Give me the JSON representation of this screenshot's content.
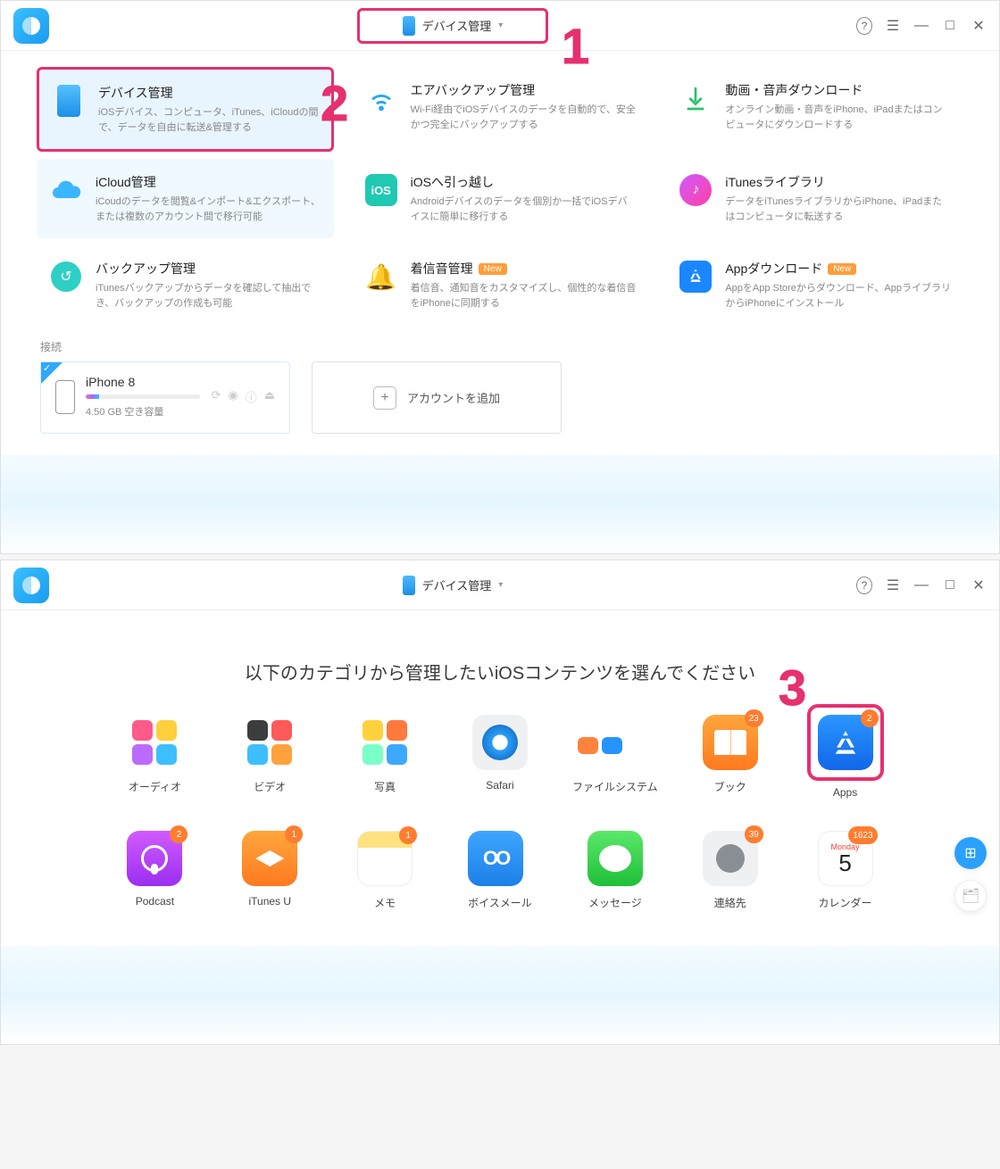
{
  "top_dropdown": "デバイス管理",
  "annotations": {
    "one": "1",
    "two": "2",
    "three": "3"
  },
  "features": [
    {
      "id": "device",
      "title": "デバイス管理",
      "desc": "iOSデバイス、コンピュータ、iTunes、iCloudの間で、データを自由に転送&管理する"
    },
    {
      "id": "air",
      "title": "エアバックアップ管理",
      "desc": "Wi-Fi経由でiOSデバイスのデータを自動的で、安全かつ完全にバックアップする"
    },
    {
      "id": "media",
      "title": "動画・音声ダウンロード",
      "desc": "オンライン動画・音声をiPhone、iPadまたはコンピュータにダウンロードする"
    },
    {
      "id": "icloud",
      "title": "iCloud管理",
      "desc": "iCoudのデータを閲覧&インポート&エクスポート、または複数のアカウント間で移行可能"
    },
    {
      "id": "move",
      "title": "iOSへ引っ越し",
      "desc": "Androidデバイスのデータを個別か一括でiOSデバイスに簡単に移行する"
    },
    {
      "id": "itunes",
      "title": "iTunesライブラリ",
      "desc": "データをiTunesライブラリからiPhone、iPadまたはコンピュータに転送する"
    },
    {
      "id": "backup",
      "title": "バックアップ管理",
      "desc": "iTunesバックアップからデータを確認して抽出でき、バックアップの作成も可能"
    },
    {
      "id": "ring",
      "title": "着信音管理",
      "desc": "着信音、通知音をカスタマイズし、個性的な着信音をiPhoneに同期する",
      "badge": "New"
    },
    {
      "id": "appdl",
      "title": "Appダウンロード",
      "desc": "AppをApp Storeからダウンロード、AppライブラリからiPhoneにインストール",
      "badge": "New"
    }
  ],
  "connect_label": "接続",
  "device": {
    "name": "iPhone 8",
    "storage": "4.50 GB 空き容量"
  },
  "add_account": "アカウントを追加",
  "w2_heading": "以下のカテゴリから管理したいiOSコンテンツを選んでください",
  "categories": [
    {
      "id": "audio",
      "label": "オーディオ"
    },
    {
      "id": "video",
      "label": "ビデオ"
    },
    {
      "id": "photo",
      "label": "写真"
    },
    {
      "id": "safari",
      "label": "Safari"
    },
    {
      "id": "files",
      "label": "ファイルシステム"
    },
    {
      "id": "book",
      "label": "ブック",
      "count": "23"
    },
    {
      "id": "apps",
      "label": "Apps",
      "count": "2"
    },
    {
      "id": "podcast",
      "label": "Podcast",
      "count": "2"
    },
    {
      "id": "itunesu",
      "label": "iTunes U",
      "count": "1"
    },
    {
      "id": "memo",
      "label": "メモ",
      "count": "1"
    },
    {
      "id": "vm",
      "label": "ボイスメール"
    },
    {
      "id": "msg",
      "label": "メッセージ"
    },
    {
      "id": "contact",
      "label": "連絡先",
      "count": "39"
    },
    {
      "id": "cal",
      "label": "カレンダー",
      "count": "1623",
      "month": "Monday",
      "day": "5"
    }
  ]
}
